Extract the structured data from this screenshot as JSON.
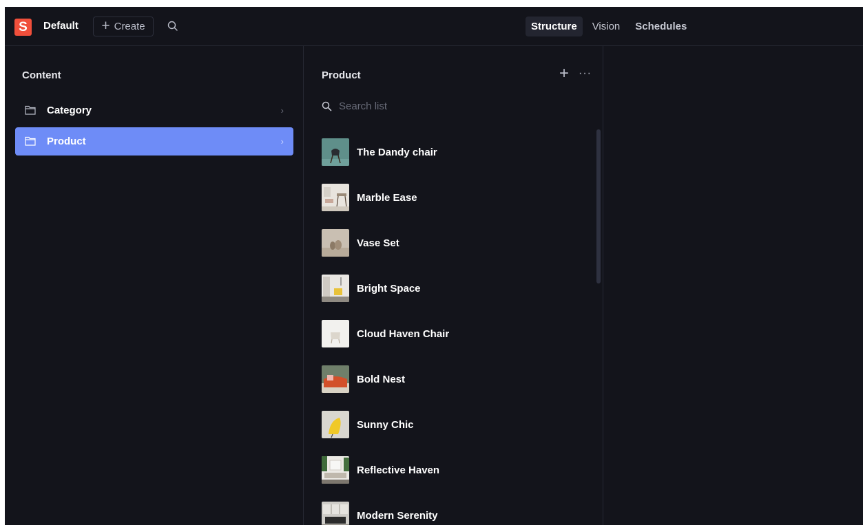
{
  "app": {
    "logo_letter": "S",
    "workspace": "Default",
    "create_label": "Create",
    "accent": "#f04f3b",
    "selection_color": "#6e8cf7"
  },
  "tabs": [
    {
      "label": "Structure",
      "active": true
    },
    {
      "label": "Vision",
      "active": false
    },
    {
      "label": "Schedules",
      "active": false
    }
  ],
  "content_pane": {
    "title": "Content",
    "items": [
      {
        "label": "Category",
        "icon": "folder-icon",
        "selected": false
      },
      {
        "label": "Product",
        "icon": "folder-icon",
        "selected": true
      }
    ]
  },
  "product_pane": {
    "title": "Product",
    "search_placeholder": "Search list",
    "items": [
      {
        "name": "The Dandy chair"
      },
      {
        "name": "Marble Ease"
      },
      {
        "name": "Vase Set"
      },
      {
        "name": "Bright Space"
      },
      {
        "name": "Cloud Haven Chair"
      },
      {
        "name": "Bold Nest"
      },
      {
        "name": "Sunny Chic"
      },
      {
        "name": "Reflective Haven"
      },
      {
        "name": "Modern Serenity"
      }
    ]
  }
}
